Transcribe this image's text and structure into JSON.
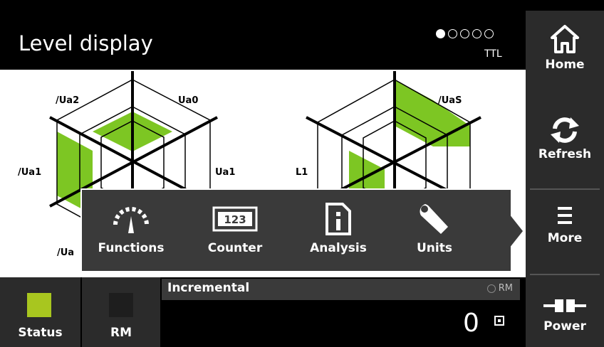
{
  "header": {
    "title": "Level display",
    "page_indicator": {
      "current": 1,
      "total": 5
    },
    "signal_type": "TTL"
  },
  "radar_left": {
    "labels": {
      "top_left": "/Ua2",
      "top_right": "Ua0",
      "mid_left": "/Ua1",
      "mid_right": "Ua1",
      "bottom_left": "/Ua"
    }
  },
  "radar_right": {
    "labels": {
      "top_right": "/UaS",
      "mid_left": "L1"
    }
  },
  "more_menu": {
    "items": [
      {
        "label": "Functions",
        "icon": "gauge-icon"
      },
      {
        "label": "Counter",
        "icon": "counter-123-icon"
      },
      {
        "label": "Analysis",
        "icon": "document-info-icon"
      },
      {
        "label": "Units",
        "icon": "wrench-icon"
      }
    ]
  },
  "sidebar": {
    "home_label": "Home",
    "refresh_label": "Refresh",
    "more_label": "More",
    "power_label": "Power"
  },
  "status_bar": {
    "status_label": "Status",
    "status_color": "#a8c61f",
    "rm_label": "RM",
    "rm_color": "#1e1e1e",
    "mode_label": "Incremental",
    "rm_indicator": "RM",
    "counter_value": "0"
  },
  "colors": {
    "accent_green": "#7dc623",
    "background": "#000000",
    "sidebar": "#2b2b2b",
    "popup": "#3a3a3a"
  }
}
